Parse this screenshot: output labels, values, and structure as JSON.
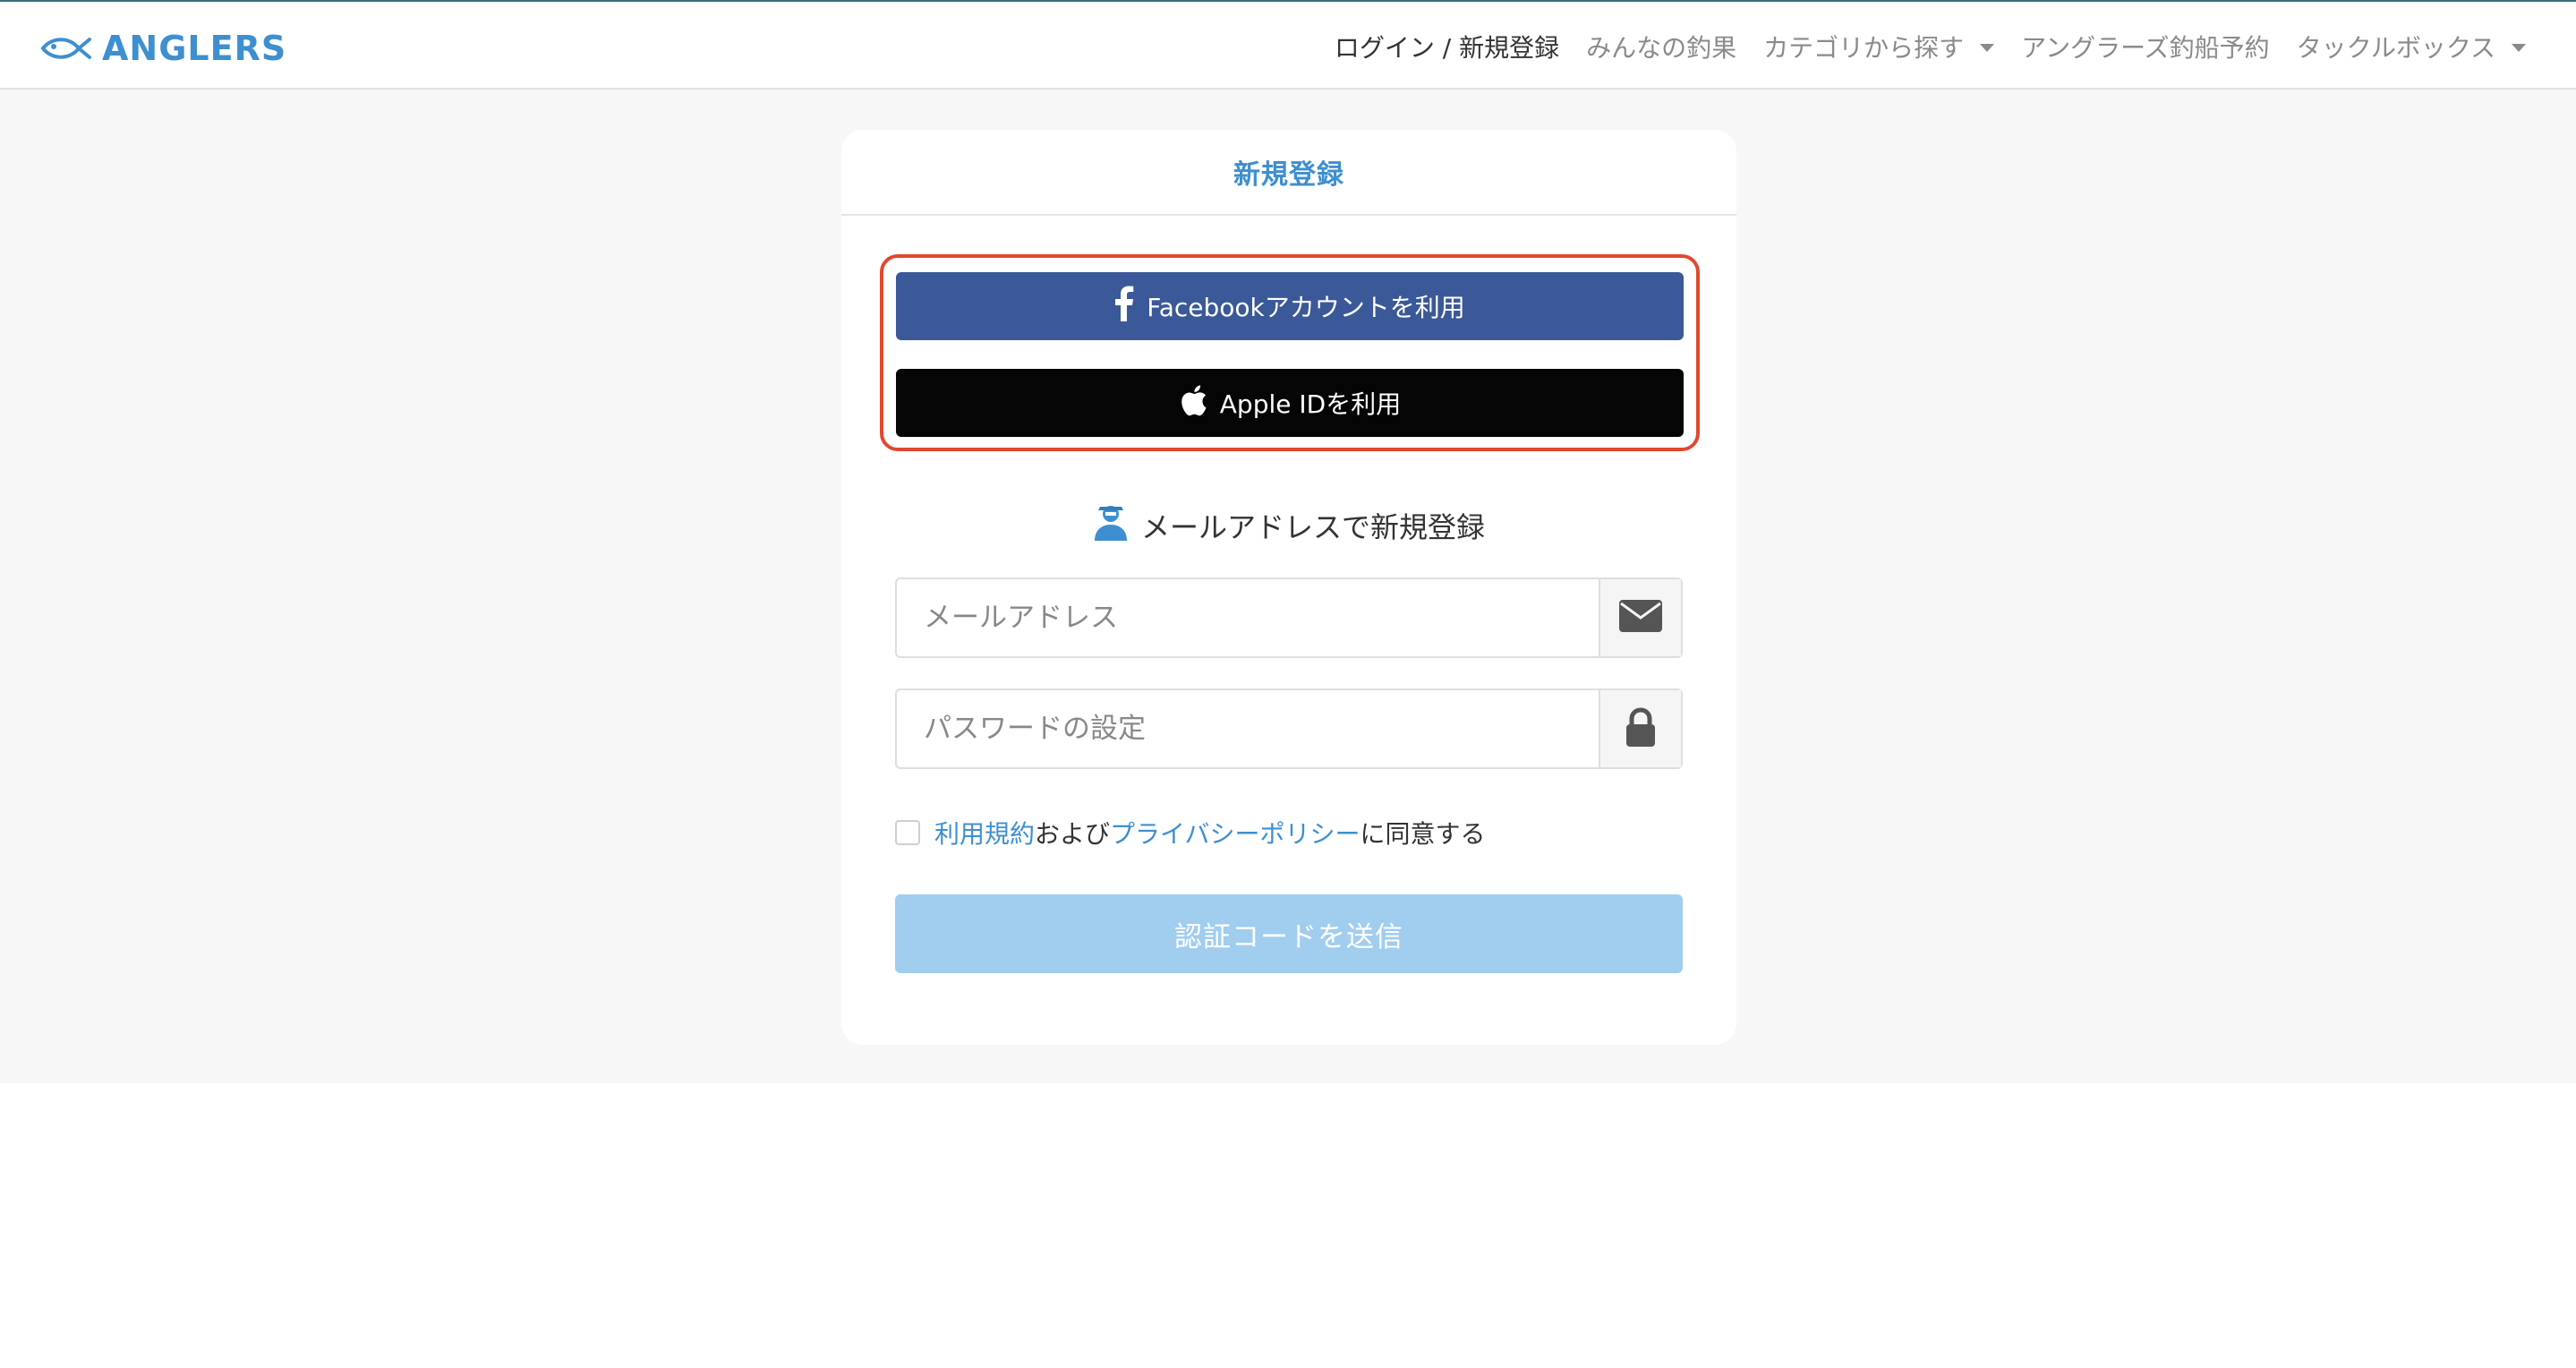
{
  "brand": {
    "name": "ANGLERS",
    "color": "#3d8fd0"
  },
  "nav": {
    "items": [
      {
        "label": "ログイン / 新規登録",
        "has_caret": false,
        "primary": true
      },
      {
        "label": "みんなの釣果",
        "has_caret": false,
        "primary": false
      },
      {
        "label": "カテゴリから探す",
        "has_caret": true,
        "primary": false
      },
      {
        "label": "アングラーズ釣船予約",
        "has_caret": false,
        "primary": false
      },
      {
        "label": "タックルボックス",
        "has_caret": true,
        "primary": false
      }
    ]
  },
  "card": {
    "title": "新規登録"
  },
  "social": {
    "facebook_label": "Facebookアカウントを利用",
    "facebook_color": "#3b5998",
    "apple_label": "Apple IDを利用",
    "apple_color": "#050505",
    "highlight_color": "#e0492f"
  },
  "email_section": {
    "heading": "メールアドレスで新規登録",
    "email_placeholder": "メールアドレス",
    "email_value": "",
    "password_placeholder": "パスワードの設定",
    "password_value": ""
  },
  "agreement": {
    "terms_link": "利用規約",
    "and_text": "および",
    "privacy_link": "プライバシーポリシー",
    "suffix": "に同意する",
    "checked": false
  },
  "submit": {
    "label": "認証コードを送信",
    "color": "#a1cdef"
  },
  "icons": {
    "logo": "fish-icon",
    "facebook": "facebook-icon",
    "apple": "apple-icon",
    "user": "user-icon",
    "email": "envelope-icon",
    "password": "lock-icon",
    "dropdown": "caret-down-icon"
  }
}
